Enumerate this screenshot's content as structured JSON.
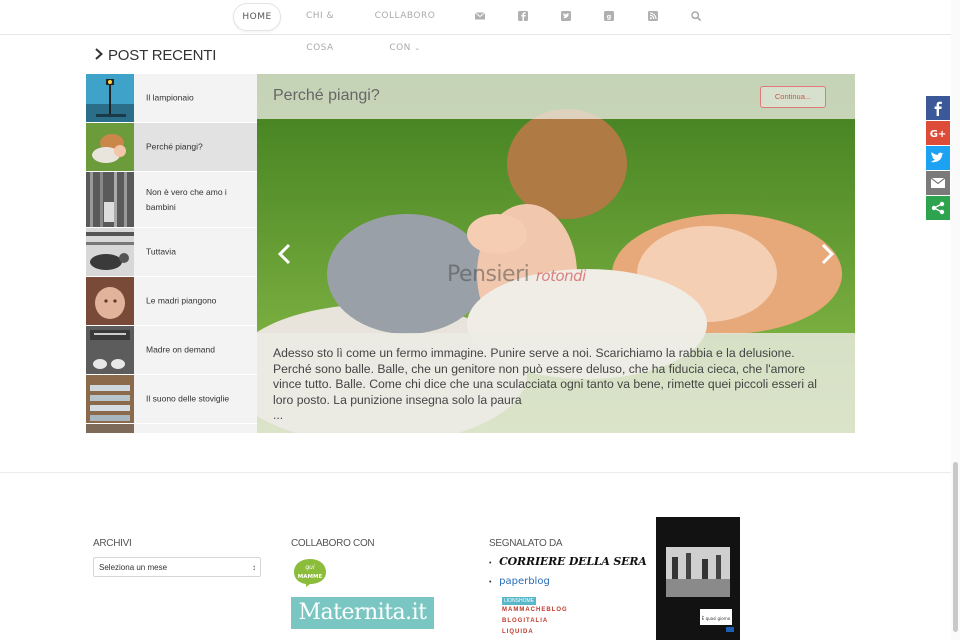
{
  "nav": {
    "home": "HOME",
    "chi": "CHI & COSA",
    "collaboro": "COLLABORO CON",
    "icons": [
      "envelope-icon",
      "facebook-icon",
      "twitter-icon",
      "google-plus-icon",
      "rss-icon",
      "search-icon"
    ]
  },
  "section": {
    "title": "POST RECENTI"
  },
  "posts": [
    {
      "label": "Il lampionaio"
    },
    {
      "label": "Perché piangi?"
    },
    {
      "label": "Non è vero che amo i bambini"
    },
    {
      "label": "Tuttavia"
    },
    {
      "label": "Le madri piangono"
    },
    {
      "label": "Madre on demand"
    },
    {
      "label": "Il suono delle stoviglie"
    }
  ],
  "slide": {
    "title": "Perché piangi?",
    "continue": "Continua...",
    "watermark_1": "Pensieri",
    "watermark_2": "rotondi",
    "excerpt": "Adesso sto lì come un fermo immagine. Punire serve a noi. Scarichiamo la rabbia e la delusione. Perché sono balle. Balle, che un genitore non può essere deluso, che ha fiducia cieca, che l'amore vince tutto. Balle. Come chi dice che una sculacciata ogni tanto va bene, rimette quei piccoli esseri al loro posto. La punizione insegna solo la paura",
    "ellipsis": "..."
  },
  "share": [
    {
      "name": "facebook",
      "color": "#3b5998"
    },
    {
      "name": "google-plus",
      "color": "#dd4b39"
    },
    {
      "name": "twitter",
      "color": "#1da1f2"
    },
    {
      "name": "email",
      "color": "#7a7a7a"
    },
    {
      "name": "more",
      "color": "#2ea44f"
    }
  ],
  "footer": {
    "archivi": "ARCHIVI",
    "archive_select": "Seleziona un mese",
    "collaboro": "COLLABORO CON",
    "qui": "qui",
    "mamme": "MAMME",
    "maternita": "Maternita.it",
    "segnalato": "SEGNALATO DA",
    "corriere": "CORRIERE DELLA SERA",
    "paperblog": "paperblog",
    "lionshome": "LIONSHOME",
    "mammacheblog": "MAMMACHEBLOG",
    "blogitalia": "BLOGITALIA",
    "liquida": "LIQUIDA",
    "book_title": "È quasi giorno"
  },
  "colors": {
    "accent": "#d05050",
    "teal": "#7ac6c2",
    "green": "#8bbd3a"
  }
}
